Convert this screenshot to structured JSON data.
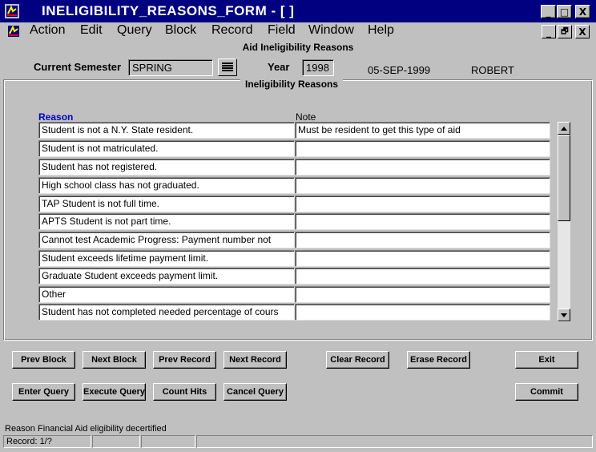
{
  "window": {
    "title": "INELIGIBILITY_REASONS_FORM - [ ]",
    "minimize_glyph": "_",
    "maximize_glyph": "□",
    "close_glyph": "X"
  },
  "menu": {
    "items": [
      "Action",
      "Edit",
      "Query",
      "Block",
      "Record",
      "Field",
      "Window",
      "Help"
    ],
    "mdi_minimize_glyph": "_",
    "mdi_restore_glyph": "🗗",
    "mdi_close_glyph": "X"
  },
  "form": {
    "title": "Aid Ineligibility Reasons",
    "semester_label": "Current Semester",
    "semester_value": "SPRING",
    "year_label": "Year",
    "year_value": "1998",
    "date": "05-SEP-1999",
    "user": "ROBERT"
  },
  "section": {
    "title": "Ineligibility Reasons",
    "col_reason": "Reason",
    "col_note": "Note"
  },
  "rows": [
    {
      "reason": "Student is not a N.Y. State resident.",
      "note": "Must be resident to get this type of aid"
    },
    {
      "reason": "Student is not matriculated.",
      "note": ""
    },
    {
      "reason": "Student has not registered.",
      "note": ""
    },
    {
      "reason": "High school class has not graduated.",
      "note": ""
    },
    {
      "reason": "TAP Student is not full time.",
      "note": ""
    },
    {
      "reason": "APTS Student is not part time.",
      "note": ""
    },
    {
      "reason": "Cannot test Academic Progress: Payment number not",
      "note": ""
    },
    {
      "reason": "Student exceeds lifetime payment limit.",
      "note": ""
    },
    {
      "reason": "Graduate Student exceeds payment limit.",
      "note": ""
    },
    {
      "reason": "Other",
      "note": ""
    },
    {
      "reason": "Student has not completed needed percentage of cours",
      "note": ""
    }
  ],
  "buttons": {
    "prev_block": "Prev Block",
    "next_block": "Next Block",
    "prev_record": "Prev Record",
    "next_record": "Next Record",
    "clear_record": "Clear Record",
    "erase_record": "Erase Record",
    "exit": "Exit",
    "enter_query": "Enter Query",
    "execute_query": "Execute Query",
    "count_hits": "Count Hits",
    "cancel_query": "Cancel Query",
    "commit": "Commit"
  },
  "status": {
    "message": "Reason Financial Aid eligibility decertified",
    "record": "Record: 1/?"
  },
  "colors": {
    "titlebar": "#000080",
    "window_bg": "#c0c0c0",
    "reason_header": "#0000c0"
  }
}
